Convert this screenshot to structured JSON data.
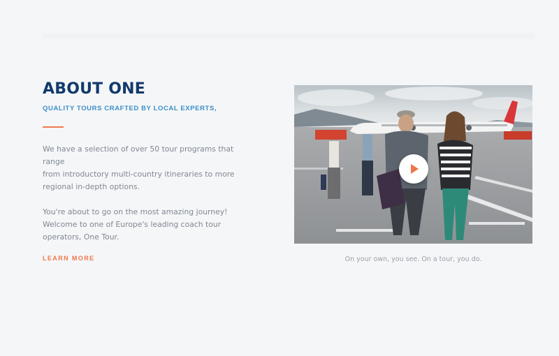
{
  "about": {
    "title": "ABOUT ONE",
    "subtitle": "QUALITY TOURS CRAFTED BY LOCAL EXPERTS,",
    "paragraph1_lines": [
      "We have a selection of over 50 tour programs that range",
      "from introductory multi-country itineraries to more",
      "regional in-depth options."
    ],
    "paragraph2_lines": [
      "You're about to go on the most amazing journey!",
      "Welcome to one of Europe's leading coach tour",
      "operators, One Tour."
    ],
    "learn_more": "LEARN MORE"
  },
  "media": {
    "caption": "On your own, you see. On a tour, you do.",
    "play_icon": "play-icon"
  },
  "colors": {
    "background": "#f5f6f8",
    "title": "#123a6b",
    "subtitle": "#3a8ec9",
    "accent": "#ee7748",
    "body_text": "#7f8891"
  }
}
